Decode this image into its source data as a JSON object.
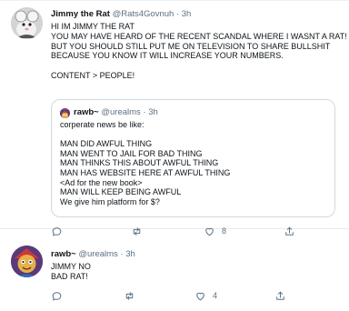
{
  "tweet": {
    "name": "Jimmy the Rat",
    "handle": "@Rats4Govnuh",
    "sep": "·",
    "time": "3h",
    "text": "HI IM JIMMY THE RAT\nYOU MAY HAVE HEARD OF THE RECENT SCANDAL WHERE I WASNT A RAT!\nBUT YOU SHOULD STILL PUT ME ON TELEVISION TO SHARE BULLSHIT\nBECAUSE YOU KNOW IT WILL INCREASE YOUR NUMBERS.\n\nCONTENT > PEOPLE!",
    "quote": {
      "name": "rawb~",
      "handle": "@urealms",
      "sep": "·",
      "time": "3h",
      "text": "corperate news be like:\n\nMAN DID AWFUL THING\nMAN WENT TO JAIL FOR BAD THING\nMAN THINKS THIS ABOUT AWFUL THING\nMAN HAS WEBSITE HERE AT AWFUL THING\n<Ad for the new book>\nMAN WILL KEEP BEING AWFUL\nWe give him platform for $?"
    },
    "actions": {
      "reply": "",
      "retweet": "",
      "like": "8",
      "share": ""
    }
  },
  "reply": {
    "name": "rawb~",
    "handle": "@urealms",
    "sep": "·",
    "time": "3h",
    "text": "JIMMY NO\nBAD RAT!",
    "actions": {
      "reply": "",
      "retweet": "",
      "like": "4",
      "share": ""
    }
  },
  "icons": {
    "reply": "reply-icon",
    "retweet": "retweet-icon",
    "like": "heart-icon",
    "share": "share-icon"
  },
  "colors": {
    "muted": "#5b7083",
    "border": "#cfd9de",
    "divider": "#e6ecf0"
  }
}
